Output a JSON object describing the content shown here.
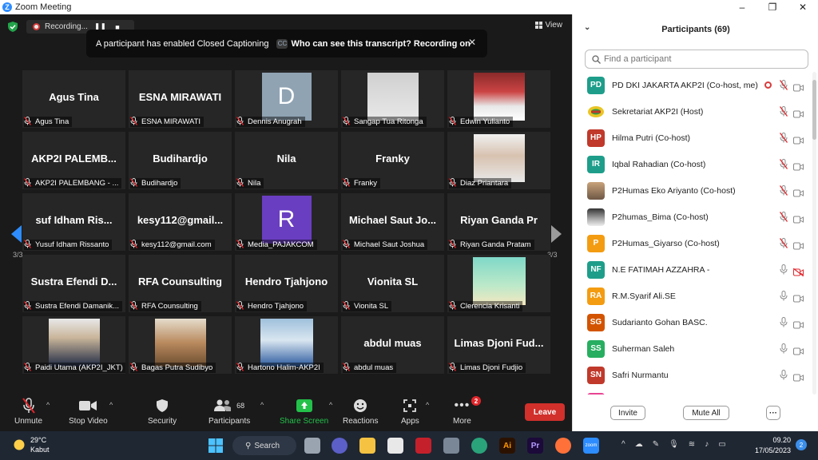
{
  "window": {
    "title": "Zoom Meeting",
    "controls": [
      "–",
      "❐",
      "✕"
    ]
  },
  "top": {
    "recording_label": "Recording...",
    "view_label": "View",
    "banner_text": "A participant has enabled Closed Captioning",
    "banner_link": "Who can see this transcript? Recording on"
  },
  "grid": {
    "page_left": "3/3",
    "page_right": "3/3",
    "tiles": [
      {
        "big": "Agus Tina",
        "label": "Agus Tina"
      },
      {
        "big": "ESNA MIRAWATI",
        "label": "ESNA MIRAWATI"
      },
      {
        "letter": "D",
        "label": "Dennis Anugrah"
      },
      {
        "photo": "man-red-tie",
        "label": "Sangap Tua Ritonga"
      },
      {
        "photo": "man-mask",
        "label": "Edwin Yulianto"
      },
      {
        "big": "AKP2I  PALEMB...",
        "label": "AKP2I PALEMBANG - ..."
      },
      {
        "big": "Budihardjo",
        "label": "Budihardjo"
      },
      {
        "big": "Nila",
        "label": "Nila"
      },
      {
        "big": "Franky",
        "label": "Franky"
      },
      {
        "photo": "man-white-shirt",
        "label": "Diaz Priantara"
      },
      {
        "big": "suf Idham Ris...",
        "label": "Yusuf Idham Rissanto"
      },
      {
        "big": "kesy112@gmail...",
        "label": "kesy112@gmail.com"
      },
      {
        "letter": "R",
        "label": "Media_PAJAKCOM"
      },
      {
        "big": "Michael Saut Jo...",
        "label": "Michael Saut Joshua"
      },
      {
        "big": "Riyan Ganda Pr",
        "label": "Riyan Ganda Pratam"
      },
      {
        "big": "Sustra Efendi D...",
        "label": "Sustra Efendi Damanik..."
      },
      {
        "big": "RFA Counsulting",
        "label": "RFA Counsulting"
      },
      {
        "big": "Hendro Tjahjono",
        "label": "Hendro Tjahjono"
      },
      {
        "big": "Vionita SL",
        "label": "Vionita SL"
      },
      {
        "photo": "sky",
        "label": "Clerencia Krisanti"
      },
      {
        "photo": "man-cap",
        "label": "Paidi Utama (AKP2I_JKT)"
      },
      {
        "photo": "man-batik",
        "label": "Bagas Putra Sudibyo"
      },
      {
        "photo": "man-mountain",
        "label": "Hartono Halim-AKP2I"
      },
      {
        "big": "abdul muas",
        "label": "abdul muas"
      },
      {
        "big": "Limas Djoni Fud...",
        "label": "Limas Djoni Fudjio"
      }
    ]
  },
  "toolbar": {
    "unmute": "Unmute",
    "stop_video": "Stop Video",
    "security": "Security",
    "participants": "Participants",
    "participants_count": "68",
    "share_screen": "Share Screen",
    "reactions": "Reactions",
    "apps": "Apps",
    "more": "More",
    "more_badge": "2",
    "leave": "Leave"
  },
  "panel": {
    "title": "Participants (69)",
    "search_placeholder": "Find a participant",
    "invite": "Invite",
    "mute_all": "Mute All",
    "more": "···",
    "participants": [
      {
        "initials": "PD",
        "color": "#1e9e8a",
        "name": "PD DKI JAKARTA AKP2I (Co-host, me)",
        "mic": "off",
        "cam": "off",
        "rec": true
      },
      {
        "initials": "",
        "color": "#ffffff",
        "name": "Sekretariat AKP2I (Host)",
        "mic": "off",
        "cam": "off",
        "logo": true
      },
      {
        "initials": "HP",
        "color": "#c0392b",
        "name": "Hilma Putri (Co-host)",
        "mic": "off",
        "cam": "off"
      },
      {
        "initials": "IR",
        "color": "#1e9e8a",
        "name": "Iqbal Rahadian (Co-host)",
        "mic": "off",
        "cam": "off"
      },
      {
        "initials": "",
        "color": "#7a6a58",
        "name": "P2Humas Eko Ariyanto (Co-host)",
        "mic": "off",
        "cam": "off",
        "photo": true
      },
      {
        "initials": "",
        "color": "#555555",
        "name": "P2humas_Bima (Co-host)",
        "mic": "off",
        "cam": "off",
        "photo": true
      },
      {
        "initials": "P",
        "color": "#f39c12",
        "name": "P2Humas_Giyarso (Co-host)",
        "mic": "off",
        "cam": "off"
      },
      {
        "initials": "NF",
        "color": "#1e9e8a",
        "name": "N.E FATIMAH AZZAHRA -",
        "mic": "on",
        "cam": "red-off"
      },
      {
        "initials": "RA",
        "color": "#f39c12",
        "name": "R.M.Syarif Ali.SE",
        "mic": "on",
        "cam": "off"
      },
      {
        "initials": "SG",
        "color": "#d35400",
        "name": "Sudarianto Gohan BASC.",
        "mic": "on",
        "cam": "off"
      },
      {
        "initials": "SS",
        "color": "#27ae60",
        "name": "Suherman Saleh",
        "mic": "on",
        "cam": "off"
      },
      {
        "initials": "SN",
        "color": "#c0392b",
        "name": "Safri Nurmantu",
        "mic": "on",
        "cam": "off"
      }
    ]
  },
  "taskbar": {
    "temp": "29°C",
    "weather": "Kabut",
    "search": "Search",
    "time": "09.20",
    "date": "17/05/2023",
    "notif_count": "2"
  }
}
